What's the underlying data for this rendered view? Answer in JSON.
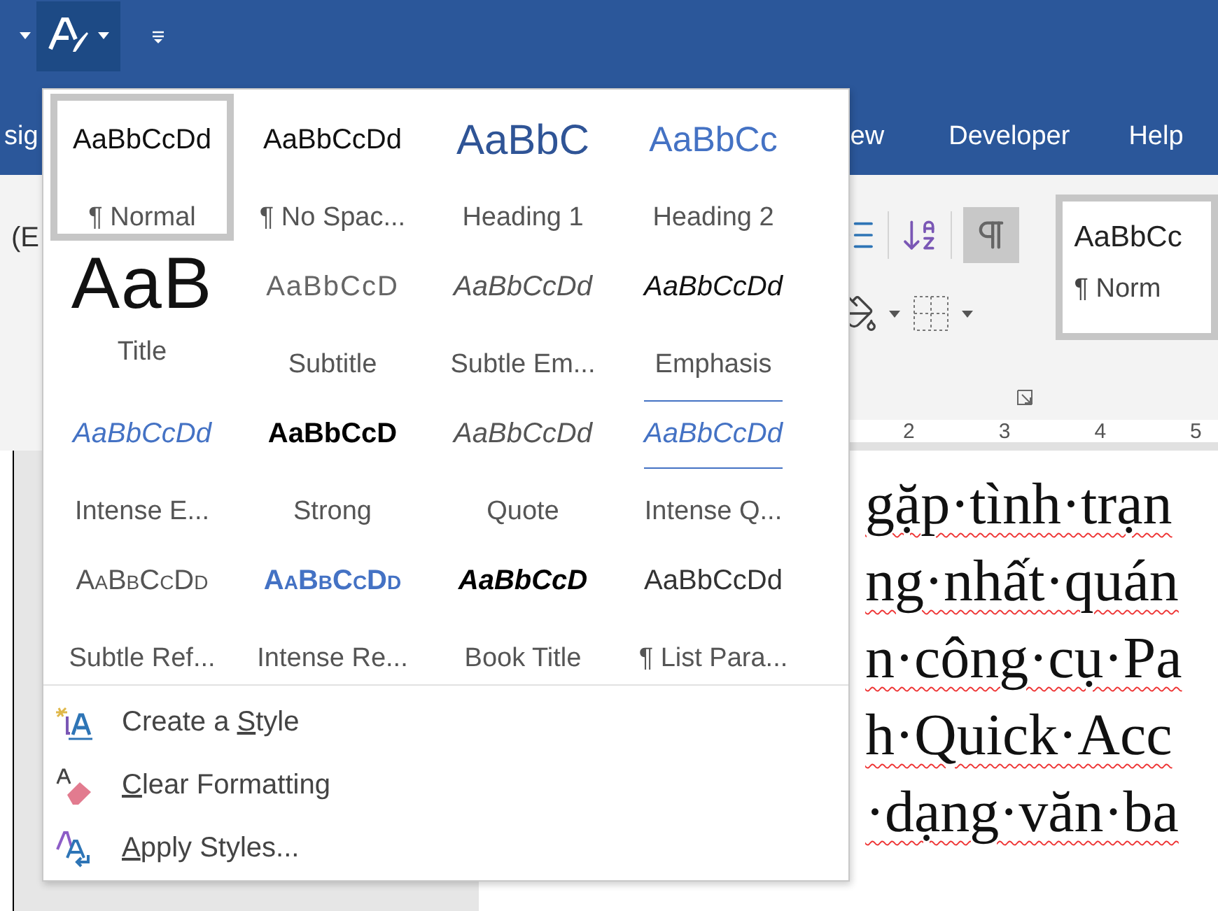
{
  "quick_access_toolbar": {
    "style_button": {
      "pressed": true
    }
  },
  "ribbon_tabs": [
    {
      "label": "sig"
    },
    {
      "label": "ew"
    },
    {
      "label": "Developer"
    },
    {
      "label": "Help"
    }
  ],
  "ribbon": {
    "font_box": "(E",
    "show_formatting_marks": {
      "on": true
    },
    "style_gallery": {
      "preview": "AaBbCc",
      "name": "¶ Norm",
      "selected": true
    }
  },
  "ruler": {
    "numbers": [
      "2",
      "3",
      "4",
      "5"
    ]
  },
  "document": {
    "lines": [
      "gặp·tình·trạn",
      "ng·nhất·quán",
      "n·công·cụ·Pa",
      "h·Quick·Acc",
      "·dạng·văn·ba"
    ]
  },
  "styles_menu": {
    "gallery": [
      {
        "kind": "normal",
        "preview": "AaBbCcDd",
        "name": "¶ Normal",
        "selected": true
      },
      {
        "kind": "no-spacing",
        "preview": "AaBbCcDd",
        "name": "¶ No Spac...",
        "selected": false
      },
      {
        "kind": "heading1",
        "preview": "AaBbC",
        "name": "Heading 1",
        "selected": false
      },
      {
        "kind": "heading2",
        "preview": "AaBbCc",
        "name": "Heading 2",
        "selected": false
      },
      {
        "kind": "title",
        "preview": "AaB",
        "name": "Title",
        "selected": false
      },
      {
        "kind": "subtitle",
        "preview": "AaBbCcD",
        "name": "Subtitle",
        "selected": false
      },
      {
        "kind": "subtle-emphasis",
        "preview": "AaBbCcDd",
        "name": "Subtle Em...",
        "selected": false
      },
      {
        "kind": "emphasis",
        "preview": "AaBbCcDd",
        "name": "Emphasis",
        "selected": false
      },
      {
        "kind": "intense-emphasis",
        "preview": "AaBbCcDd",
        "name": "Intense E...",
        "selected": false
      },
      {
        "kind": "strong",
        "preview": "AaBbCcD",
        "name": "Strong",
        "selected": false
      },
      {
        "kind": "quote",
        "preview": "AaBbCcDd",
        "name": "Quote",
        "selected": false
      },
      {
        "kind": "intense-quote",
        "preview": "AaBbCcDd",
        "name": "Intense Q...",
        "selected": false
      },
      {
        "kind": "subtle-reference",
        "preview": "AaBbCcDd",
        "name": "Subtle Ref...",
        "selected": false
      },
      {
        "kind": "intense-reference",
        "preview": "AaBbCcDd",
        "name": "Intense Re...",
        "selected": false
      },
      {
        "kind": "book-title",
        "preview": "AaBbCcD",
        "name": "Book Title",
        "selected": false
      },
      {
        "kind": "list-paragraph",
        "preview": "AaBbCcDd",
        "name": "¶ List Para...",
        "selected": false
      }
    ],
    "commands": [
      {
        "kind": "create",
        "before": "Create a ",
        "key": "S",
        "after": "tyle"
      },
      {
        "kind": "clear",
        "key": "C",
        "after": "lear Formatting"
      },
      {
        "kind": "apply",
        "key": "A",
        "after": "pply Styles..."
      }
    ]
  }
}
